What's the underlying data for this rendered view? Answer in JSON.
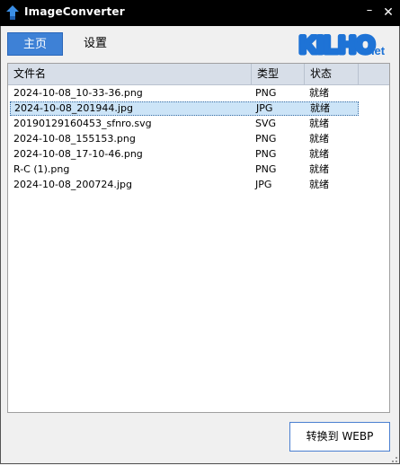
{
  "window": {
    "title": "ImageConverter",
    "minimize": "–",
    "close": "✕"
  },
  "nav": {
    "home_label": "主页",
    "settings_label": "设置"
  },
  "logo": {
    "text": "KILHO",
    "suffix": ".net"
  },
  "table": {
    "columns": [
      "文件名",
      "类型",
      "状态"
    ],
    "rows": [
      {
        "name": "2024-10-08_10-33-36.png",
        "type": "PNG",
        "status": "就绪"
      },
      {
        "name": "2024-10-08_201944.jpg",
        "type": "JPG",
        "status": "就绪",
        "selected": true
      },
      {
        "name": "20190129160453_sfnro.svg",
        "type": "SVG",
        "status": "就绪"
      },
      {
        "name": "2024-10-08_155153.png",
        "type": "PNG",
        "status": "就绪"
      },
      {
        "name": "2024-10-08_17-10-46.png",
        "type": "PNG",
        "status": "就绪"
      },
      {
        "name": "R-C (1).png",
        "type": "PNG",
        "status": "就绪"
      },
      {
        "name": "2024-10-08_200724.jpg",
        "type": "JPG",
        "status": "就绪"
      }
    ]
  },
  "actions": {
    "convert_label": "转换到 WEBP"
  },
  "colors": {
    "accent": "#3e81d6",
    "logo_blue": "#1e73d6",
    "titlebar": "#000000"
  }
}
